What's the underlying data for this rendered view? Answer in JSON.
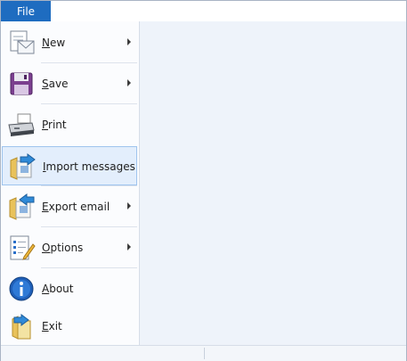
{
  "file_tab": {
    "label": "File"
  },
  "menu": {
    "items": [
      {
        "id": "new",
        "accel": "N",
        "rest": "ew",
        "submenu": true,
        "icon": "new-document-icon"
      },
      {
        "id": "save",
        "accel": "S",
        "rest": "ave",
        "submenu": true,
        "icon": "floppy-disk-icon"
      },
      {
        "id": "print",
        "accel": "P",
        "rest": "rint",
        "submenu": false,
        "icon": "printer-icon"
      },
      {
        "id": "import",
        "accel": "I",
        "rest": "mport messages",
        "submenu": false,
        "selected": true,
        "icon": "import-folder-icon"
      },
      {
        "id": "export",
        "accel": "E",
        "rest": "xport email",
        "submenu": true,
        "icon": "export-folder-icon"
      },
      {
        "id": "options",
        "accel": "O",
        "rest": "ptions",
        "submenu": true,
        "icon": "options-checklist-icon"
      },
      {
        "id": "about",
        "accel": "A",
        "rest": "bout",
        "submenu": false,
        "icon": "info-icon"
      },
      {
        "id": "exit",
        "accel": "E",
        "rest": "xit",
        "submenu": false,
        "icon": "exit-folder-icon"
      }
    ]
  },
  "colors": {
    "file_tab_bg": "#1e6cc0",
    "selection_bg": "#e3eefc",
    "selection_border": "#9fc4ee",
    "content_bg": "#eef3fa"
  }
}
